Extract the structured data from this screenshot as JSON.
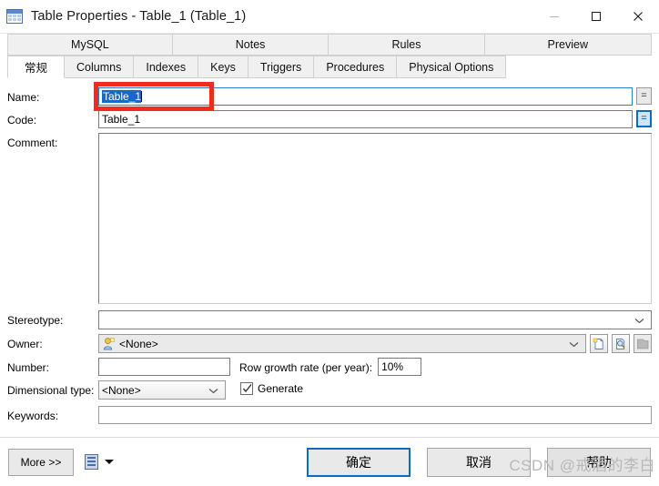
{
  "window": {
    "title": "Table Properties - Table_1 (Table_1)",
    "icon": "table-grid-icon",
    "minimize_label": "—",
    "maximize_label": "□",
    "close_label": "✕"
  },
  "tabs": {
    "row1": [
      {
        "label": "MySQL",
        "active": false
      },
      {
        "label": "Notes",
        "active": false
      },
      {
        "label": "Rules",
        "active": false
      },
      {
        "label": "Preview",
        "active": false
      }
    ],
    "row2": [
      {
        "label": "常规",
        "active": true
      },
      {
        "label": "Columns",
        "active": false
      },
      {
        "label": "Indexes",
        "active": false
      },
      {
        "label": "Keys",
        "active": false
      },
      {
        "label": "Triggers",
        "active": false
      },
      {
        "label": "Procedures",
        "active": false
      },
      {
        "label": "Physical Options",
        "active": false
      }
    ]
  },
  "form": {
    "name_label": "Name:",
    "name_value": "Table_1",
    "name_equals_button": "=",
    "code_label": "Code:",
    "code_value": "Table_1",
    "code_equals_button": "=",
    "comment_label": "Comment:",
    "comment_value": "",
    "stereotype_label": "Stereotype:",
    "stereotype_value": "",
    "owner_label": "Owner:",
    "owner_value": "<None>",
    "number_label": "Number:",
    "number_value": "",
    "row_growth_label": "Row growth rate (per year):",
    "row_growth_value": "10%",
    "dimensional_type_label": "Dimensional type:",
    "dimensional_type_value": "<None>",
    "generate_label": "Generate",
    "generate_checked": true,
    "keywords_label": "Keywords:",
    "keywords_value": ""
  },
  "footer": {
    "more_label": "More >>",
    "report_icon": "report-icon",
    "dropdown_icon": "chevron-down-icon",
    "ok_label": "确定",
    "cancel_label": "取消",
    "help_label": "帮助"
  },
  "watermark": {
    "text": "CSDN @戒酒的李白"
  },
  "colors": {
    "accent": "#0a6cc4",
    "selection": "#1669c8",
    "annotation": "#f02b20",
    "tab_inactive": "#f0f0f0",
    "border": "#7a7a7a"
  }
}
